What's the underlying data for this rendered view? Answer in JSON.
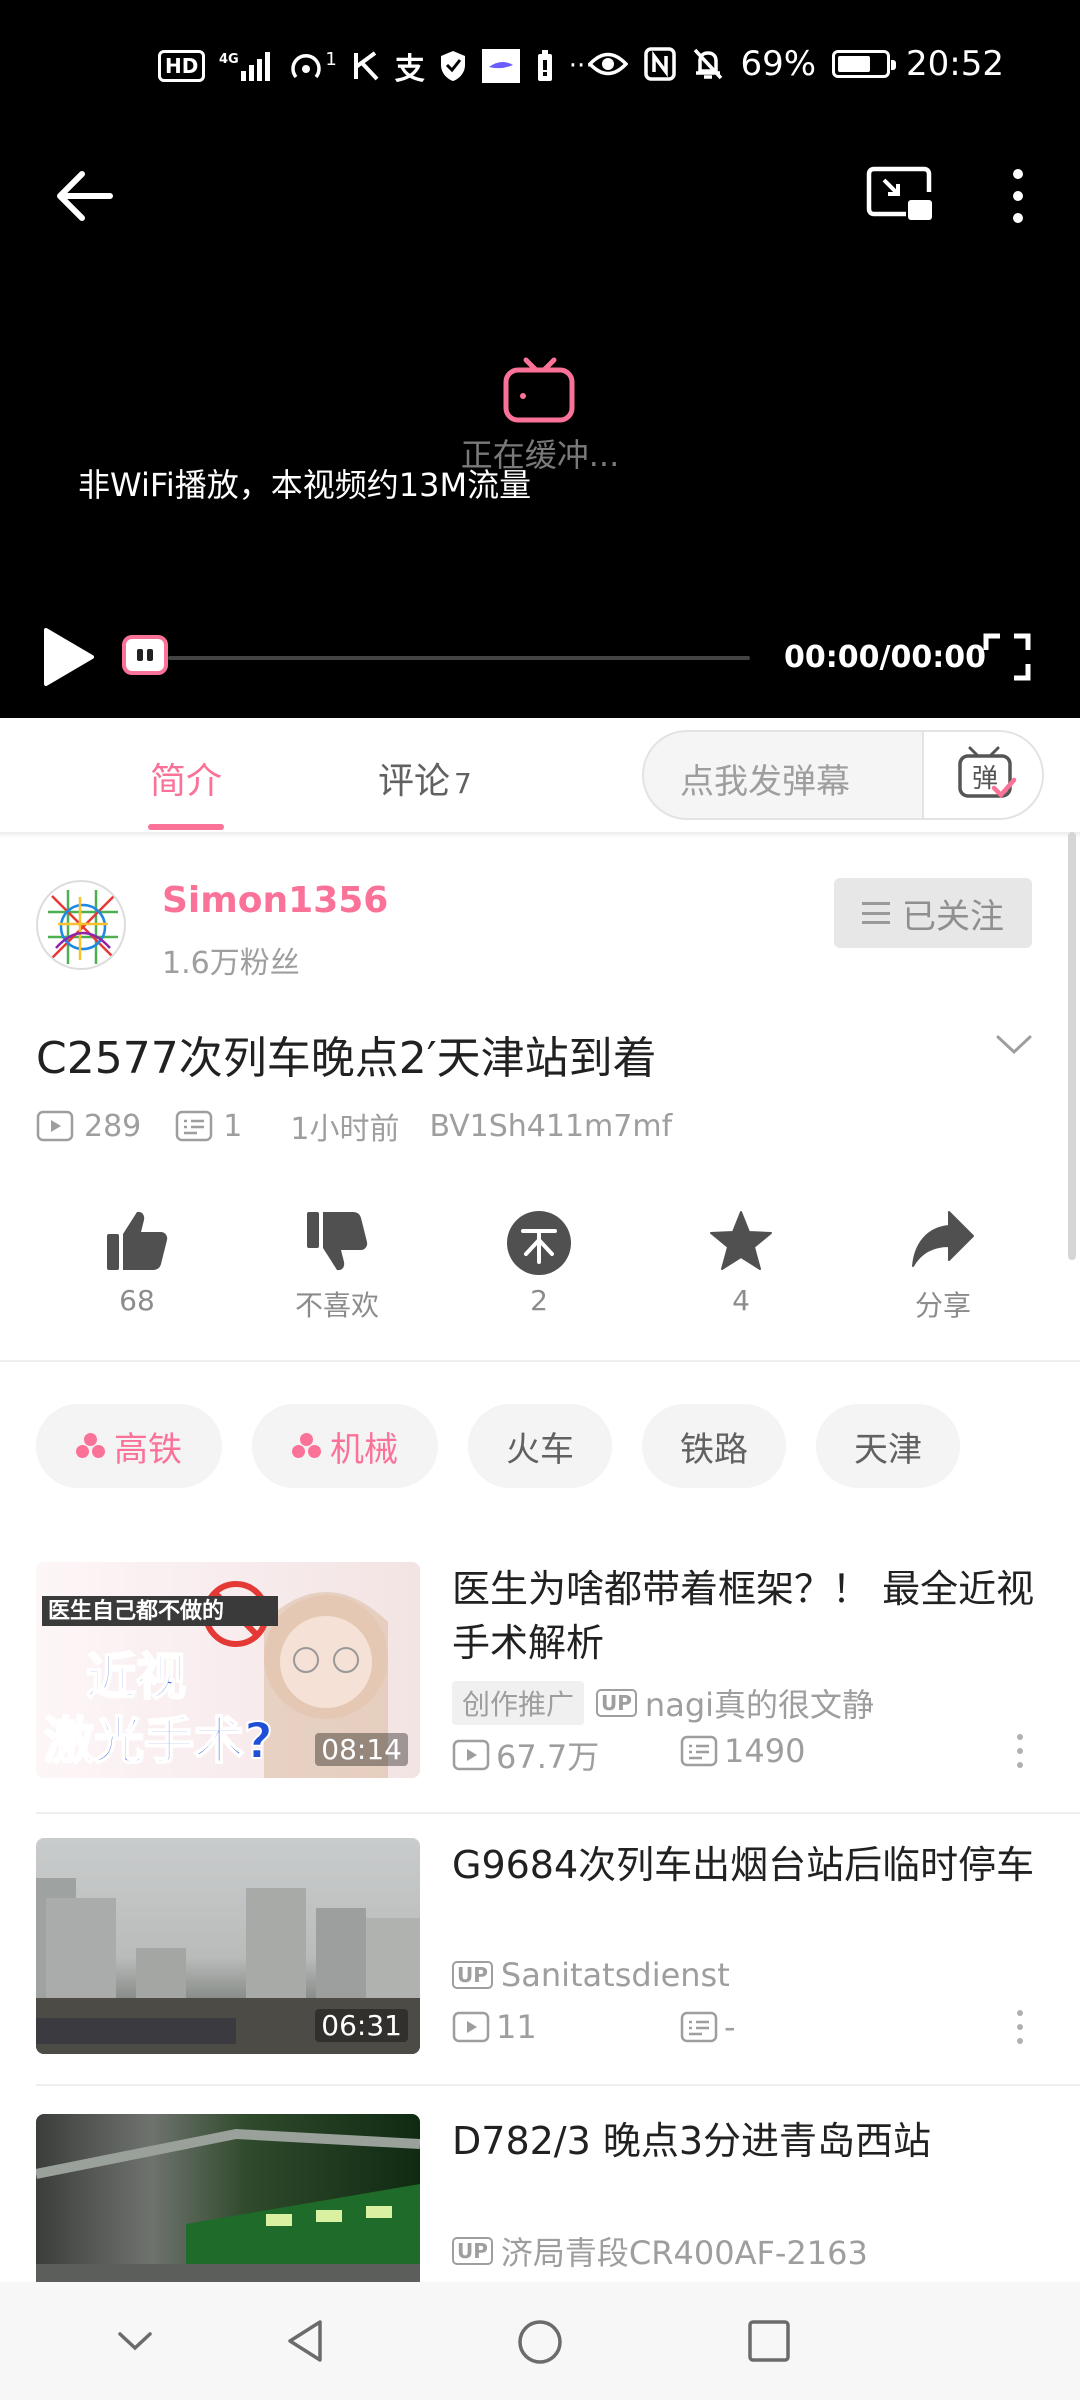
{
  "status_bar": {
    "left_icons": [
      "hd-icon",
      "4g-signal-icon",
      "hotspot-icon",
      "k-app-icon",
      "alipay-icon",
      "shield-icon",
      "app-notify-icon",
      "battery-saver-icon"
    ],
    "hd_label": "HD",
    "hotspot_count": "1",
    "more_dots": "···",
    "battery_percent": "69%",
    "battery_level": 0.69,
    "time": "20:52"
  },
  "player": {
    "buffering_text": "正在缓冲...",
    "data_notice": "非WiFi播放，本视频约13M流量",
    "time": "00:00/00:00",
    "progress": 0
  },
  "tabs": {
    "intro_label": "简介",
    "comments_label": "评论",
    "comments_count": "7",
    "danmaku_placeholder": "点我发弹幕",
    "danmaku_button_label": "弹"
  },
  "uploader": {
    "name": "Simon1356",
    "fans": "1.6万粉丝",
    "follow_label": "已关注"
  },
  "video": {
    "title": "C2577次列车晚点2′天津站到着",
    "plays": "289",
    "danmaku": "1",
    "time_ago": "1小时前",
    "bvid": "BV1Sh411m7mf"
  },
  "actions": {
    "like_count": "68",
    "dislike_label": "不喜欢",
    "coin_count": "2",
    "fav_count": "4",
    "share_label": "分享"
  },
  "tags": [
    {
      "label": "高铁",
      "highlight": true
    },
    {
      "label": "机械",
      "highlight": true
    },
    {
      "label": "火车",
      "highlight": false
    },
    {
      "label": "铁路",
      "highlight": false
    },
    {
      "label": "天津",
      "highlight": false
    }
  ],
  "related": [
    {
      "title": "医生为啥都带着框架？！ 最全近视手术解析",
      "promo": "创作推广",
      "up_badge": "UP",
      "up": "nagi真的很文静",
      "plays": "67.7万",
      "danmaku": "1490",
      "duration": "08:14",
      "thumb_text_1": "医生自己都不做的",
      "thumb_text_2": "近视",
      "thumb_text_3": "激光手术?"
    },
    {
      "title": "G9684次列车出烟台站后临时停车",
      "up_badge": "UP",
      "up": "Sanitatsdienst",
      "plays": "11",
      "danmaku": "-",
      "duration": "06:31"
    },
    {
      "title": "D782/3  晚点3分进青岛西站",
      "up_badge": "UP",
      "up": "济局青段CR400AF-2163"
    }
  ],
  "colors": {
    "accent": "#fb7299",
    "text_primary": "#212121",
    "text_secondary": "#9e9e9e"
  }
}
